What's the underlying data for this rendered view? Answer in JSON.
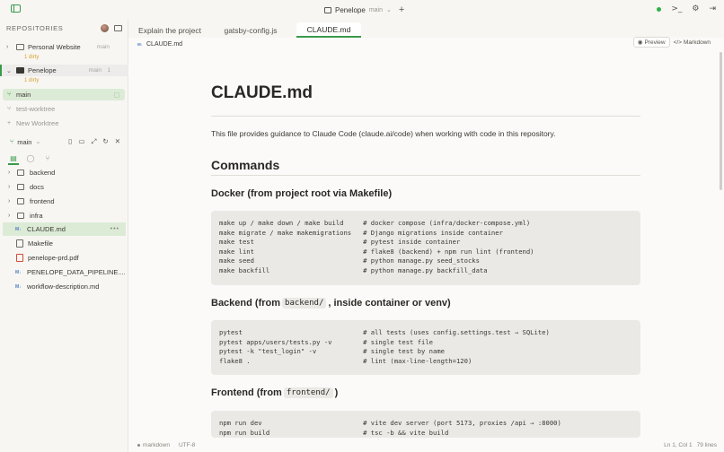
{
  "topbar": {
    "repo_name": "Penelope",
    "branch": "main",
    "chevron": "⌄",
    "plus": "+",
    "terminal_icon": ">_",
    "settings_icon": "⚙",
    "exit_icon": "⇥"
  },
  "sidebar": {
    "title": "REPOSITORIES",
    "repos": [
      {
        "name": "Personal Website",
        "tag": "main",
        "dirty": "1 dirty",
        "chevron": "›"
      },
      {
        "name": "Penelope",
        "tag": "main",
        "count": "1",
        "dirty": "1 dirty",
        "chevron": "⌄"
      }
    ],
    "worktrees": [
      {
        "label": "main",
        "icon": "⑂"
      },
      {
        "label": "test-worktree",
        "icon": "⑂"
      },
      {
        "label": "New Worktree",
        "icon": "+"
      }
    ],
    "branch_label": "main",
    "branch_chevron": "⌄",
    "tree": [
      {
        "label": "backend",
        "kind": "folder"
      },
      {
        "label": "docs",
        "kind": "folder"
      },
      {
        "label": "frontend",
        "kind": "folder"
      },
      {
        "label": "infra",
        "kind": "folder"
      },
      {
        "label": "CLAUDE.md",
        "kind": "md"
      },
      {
        "label": "Makefile",
        "kind": "file"
      },
      {
        "label": "penelope-prd.pdf",
        "kind": "pdf"
      },
      {
        "label": "PENELOPE_DATA_PIPELINE....",
        "kind": "md"
      },
      {
        "label": "workflow-description.md",
        "kind": "md"
      }
    ],
    "more": "•••"
  },
  "tabs": [
    {
      "label": "Explain the project"
    },
    {
      "label": "gatsby-config.js"
    },
    {
      "label": "CLAUDE.md"
    }
  ],
  "subbar": {
    "badge": "M↓",
    "filename": "CLAUDE.md",
    "preview_label": "Preview",
    "markdown_label": "Markdown",
    "preview_icon": "◉",
    "markdown_icon": "</>"
  },
  "doc": {
    "h1": "CLAUDE.md",
    "intro": "This file provides guidance to Claude Code (claude.ai/code) when working with code in this repository.",
    "h2": "Commands",
    "docker_heading": "Docker (from project root via Makefile)",
    "docker_code": "make up / make down / make build     # docker compose (infra/docker-compose.yml)\nmake migrate / make makemigrations   # Django migrations inside container\nmake test                            # pytest inside container\nmake lint                            # flake8 (backend) + npm run lint (frontend)\nmake seed                            # python manage.py seed_stocks\nmake backfill                        # python manage.py backfill_data",
    "backend_heading_pre": "Backend (from",
    "backend_heading_code": "backend/",
    "backend_heading_post": ", inside container or venv)",
    "backend_code": "pytest                               # all tests (uses config.settings.test → SQLite)\npytest apps/users/tests.py -v        # single test file\npytest -k \"test_login\" -v            # single test by name\nflake8 .                             # lint (max-line-length=120)",
    "frontend_heading_pre": "Frontend (from",
    "frontend_heading_code": "frontend/",
    "frontend_heading_post": ")",
    "frontend_code": "npm run dev                          # vite dev server (port 5173, proxies /api → :8000)\nnpm run build                        # tsc -b && vite build"
  },
  "status": {
    "language": "markdown",
    "encoding": "UTF-8",
    "position": "Ln 1, Col 1",
    "lines": "79 lines"
  }
}
